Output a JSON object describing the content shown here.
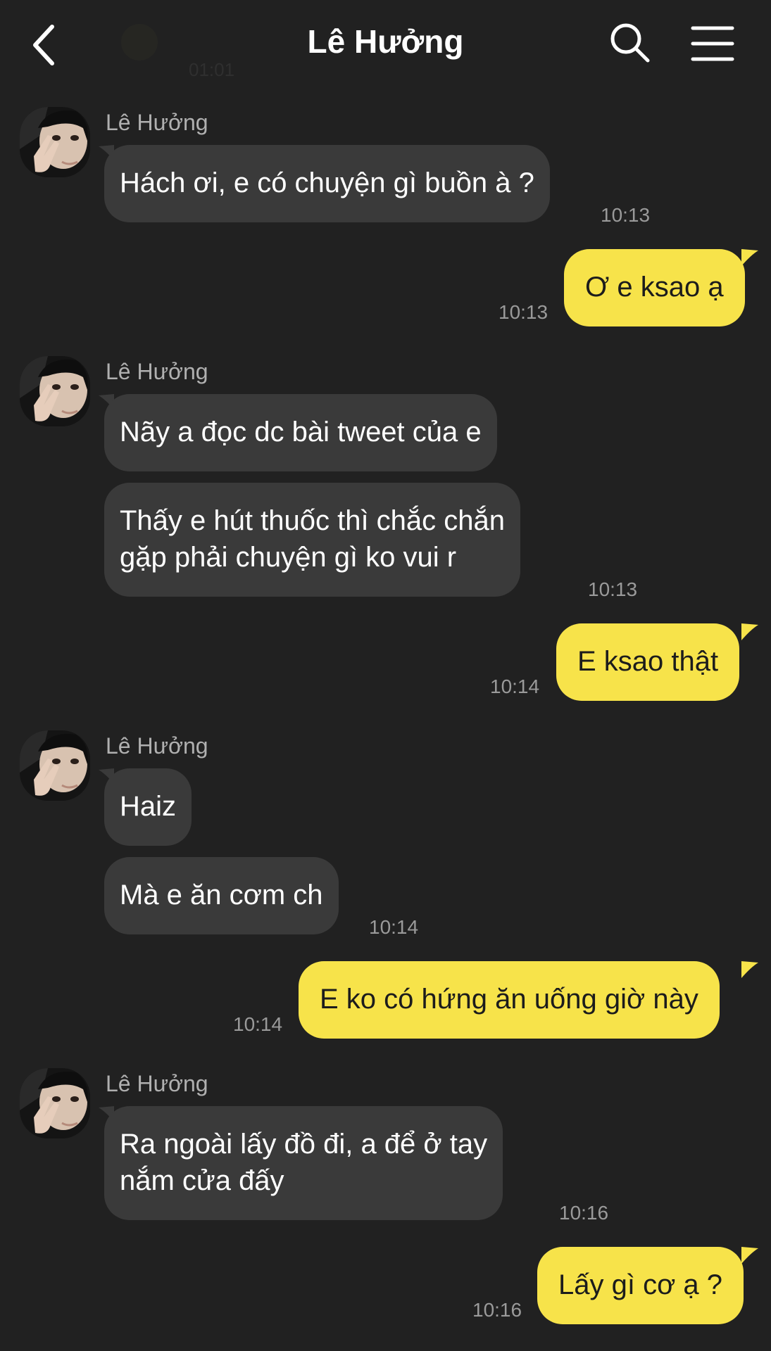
{
  "header": {
    "title": "Lê Hưởng",
    "partial_time": "01:01",
    "back_icon": "chevron-left-icon",
    "search_icon": "search-icon",
    "menu_icon": "hamburger-menu-icon"
  },
  "colors": {
    "background": "#212121",
    "incoming_bubble": "#3a3a3a",
    "outgoing_bubble": "#f7e34a",
    "timestamp": "#9a9a9a"
  },
  "messages": [
    {
      "sender": "Lê Hưởng",
      "text": "Hách ơi, e có chuyện gì buồn à ?",
      "time": "10:13"
    },
    {
      "text": "Ơ e ksao ạ",
      "time": "10:13"
    },
    {
      "sender": "Lê Hưởng",
      "text": "Nãy a đọc dc bài tweet của e"
    },
    {
      "text_line1": "Thấy e hút thuốc thì chắc chắn",
      "text_line2": "gặp phải chuyện gì ko vui r",
      "time": "10:13"
    },
    {
      "text": "E ksao thật",
      "time": "10:14"
    },
    {
      "sender": "Lê Hưởng",
      "text": "Haiz"
    },
    {
      "text": "Mà e ăn cơm ch",
      "time": "10:14"
    },
    {
      "text": "E ko có hứng ăn uống giờ này",
      "time": "10:14"
    },
    {
      "sender": "Lê Hưởng",
      "text_line1": "Ra ngoài lấy đồ đi, a để ở tay",
      "text_line2": "nắm cửa đấy",
      "time": "10:16"
    },
    {
      "text": "Lấy gì cơ ạ ?",
      "time": "10:16"
    }
  ]
}
